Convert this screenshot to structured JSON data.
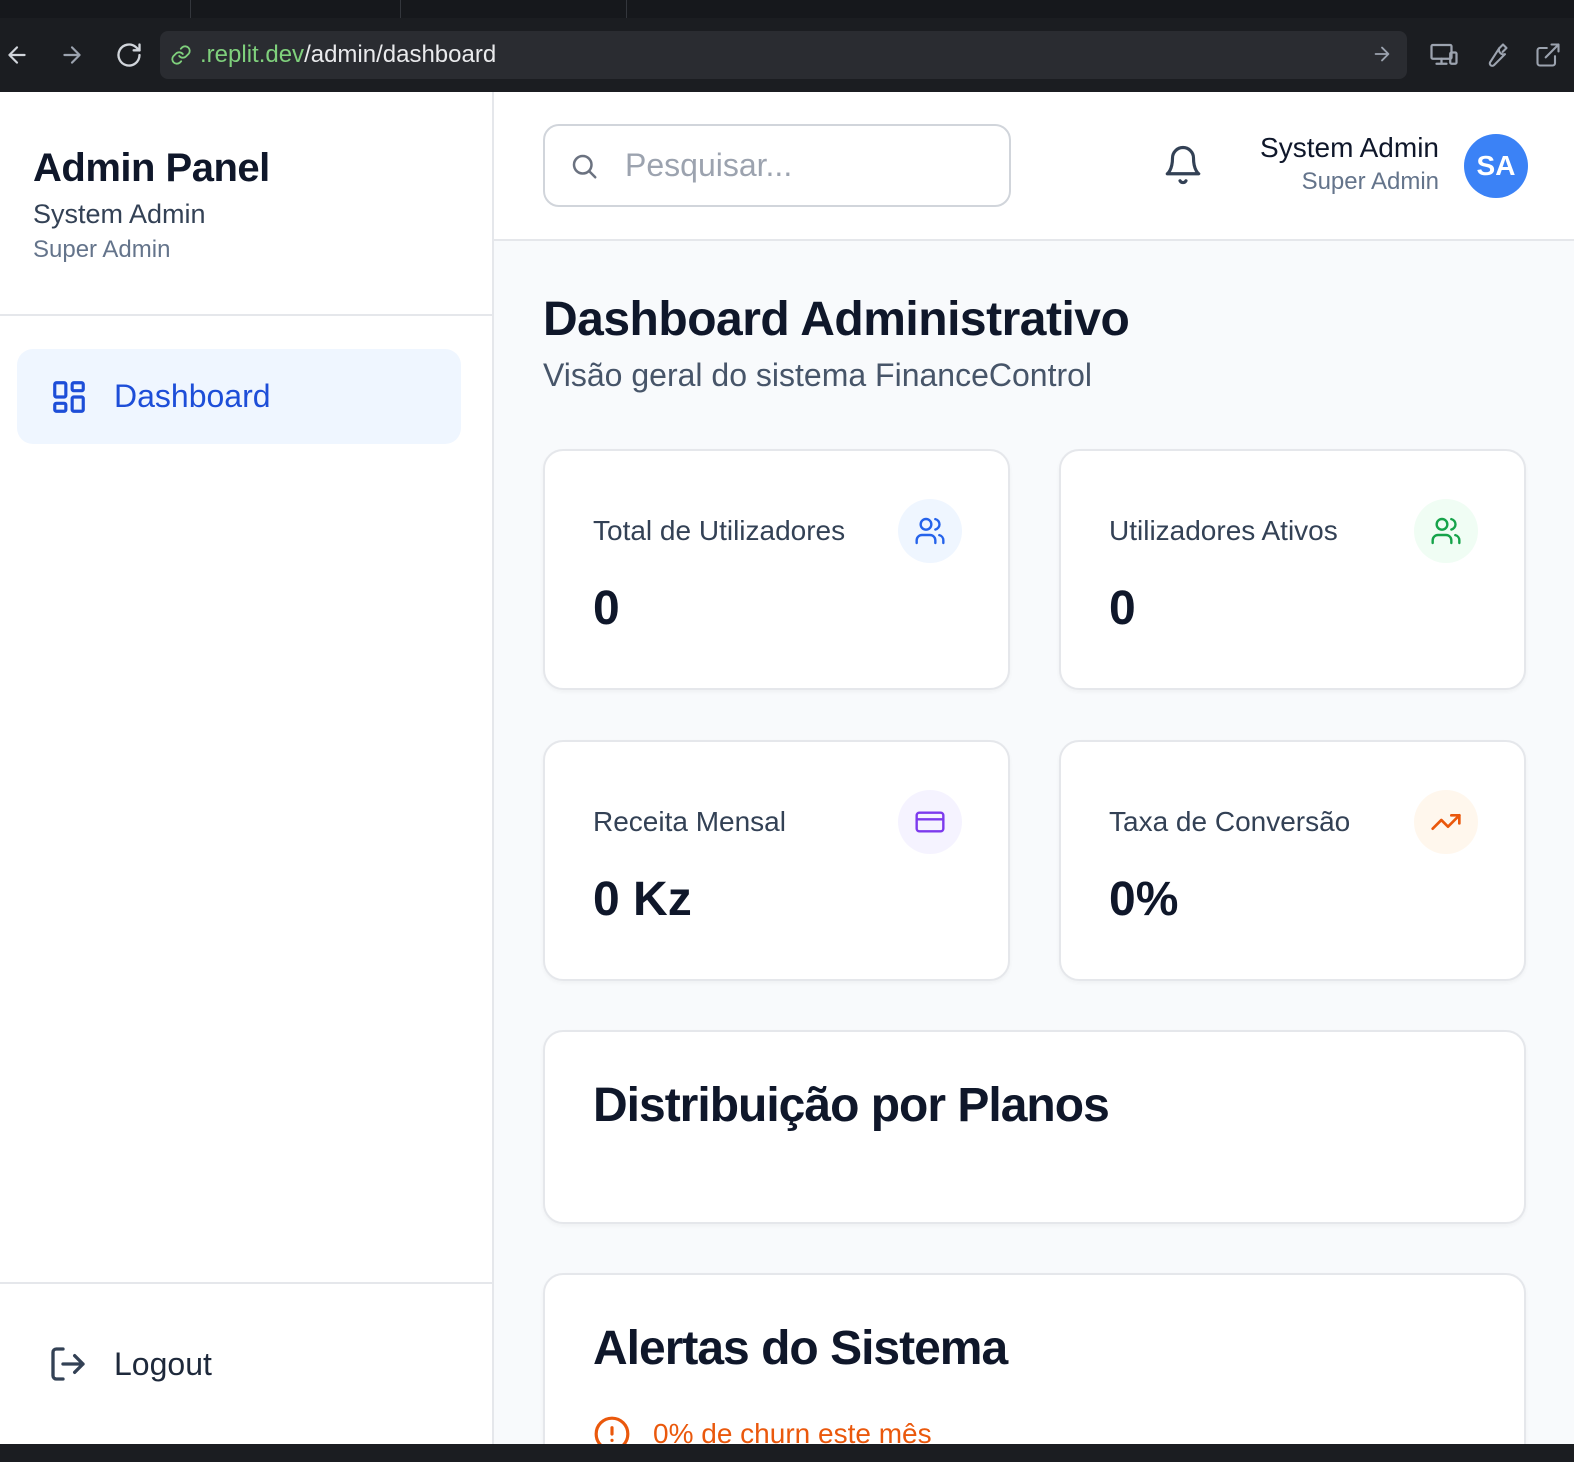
{
  "browser": {
    "url_host": ".replit.dev",
    "url_path": "/admin/dashboard"
  },
  "sidebar": {
    "brand_title": "Admin Panel",
    "user_name": "System Admin",
    "user_role": "Super Admin",
    "nav_items": [
      {
        "label": "Dashboard",
        "icon": "layout-dashboard-icon",
        "active": true
      }
    ],
    "logout_label": "Logout"
  },
  "header": {
    "search_placeholder": "Pesquisar...",
    "user_name": "System Admin",
    "user_role": "Super Admin",
    "avatar_initials": "SA"
  },
  "main": {
    "title": "Dashboard Administrativo",
    "subtitle": "Visão geral do sistema FinanceControl",
    "stats": [
      {
        "label": "Total de Utilizadores",
        "value": "0",
        "icon": "users-icon",
        "color": "#2563eb",
        "bg": "#eff6ff"
      },
      {
        "label": "Utilizadores Ativos",
        "value": "0",
        "icon": "users-icon",
        "color": "#16a34a",
        "bg": "#f0fdf4"
      },
      {
        "label": "Receita Mensal",
        "value": "0 Kz",
        "icon": "credit-card-icon",
        "color": "#7c3aed",
        "bg": "#f5f3ff"
      },
      {
        "label": "Taxa de Conversão",
        "value": "0%",
        "icon": "trending-up-icon",
        "color": "#ea580c",
        "bg": "#fff7ed"
      }
    ],
    "plans_section_title": "Distribuição por Planos",
    "alerts_section_title": "Alertas do Sistema",
    "alerts": [
      {
        "text": "0% de churn este mês",
        "icon": "alert-circle-icon",
        "color": "#ea580c"
      }
    ]
  }
}
